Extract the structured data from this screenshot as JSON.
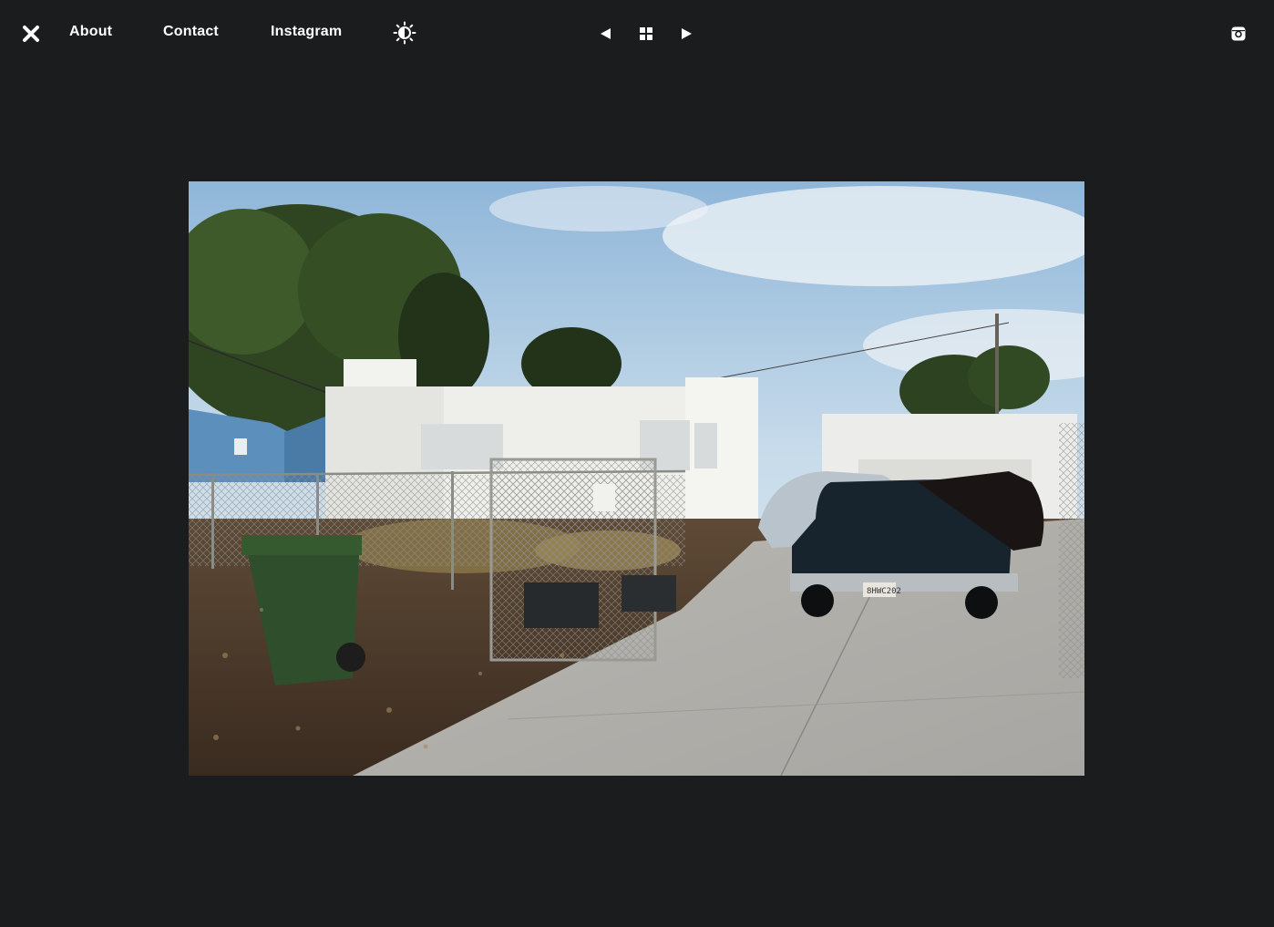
{
  "nav": {
    "close_icon": "close-x-icon",
    "links": {
      "about": "About",
      "contact": "Contact",
      "instagram": "Instagram"
    },
    "theme_toggle_icon": "half-sun-theme-icon"
  },
  "pager": {
    "prev_icon": "triangle-left-icon",
    "grid_icon": "grid-four-squares-icon",
    "next_icon": "triangle-right-icon"
  },
  "social": {
    "instagram_icon": "instagram-camera-icon"
  },
  "photo": {
    "subject": "white stucco house with chain-link fence, green bin and parked vintage cars in driveway",
    "license_plate": "8HWC202"
  },
  "colors": {
    "background": "#1b1c1e",
    "text": "#ffffff"
  }
}
